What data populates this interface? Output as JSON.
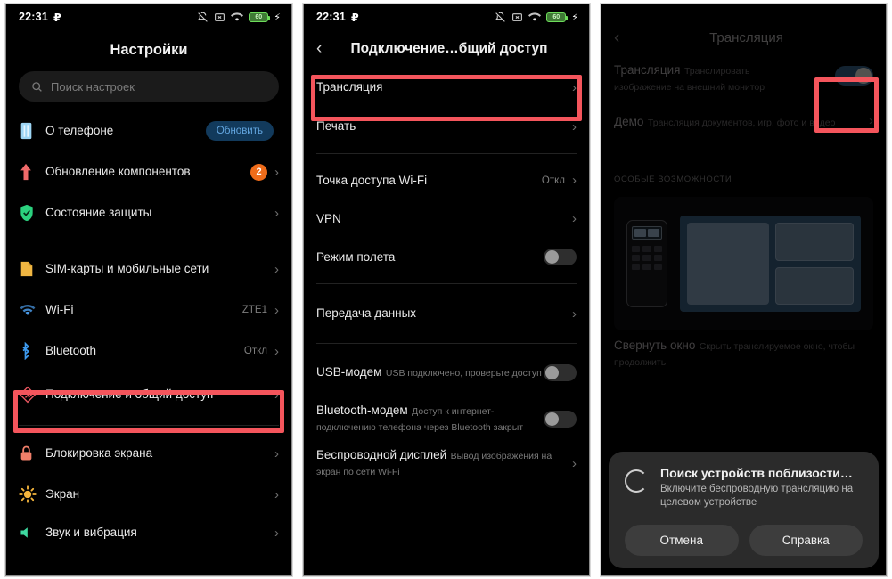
{
  "status_bar": {
    "time": "22:31",
    "currency_glyph": "₽",
    "icons": [
      "bell-off-icon",
      "no-sim-icon",
      "wifi-icon",
      "battery-icon",
      "charging-bolt-icon"
    ],
    "battery_level": "60"
  },
  "screen1": {
    "title": "Настройки",
    "search": {
      "placeholder": "Поиск настроек",
      "value": ""
    },
    "groups": [
      {
        "items": [
          {
            "label": "О телефоне",
            "icon": "phone-info-icon",
            "action_label": "Обновить",
            "action_type": "pill"
          },
          {
            "label": "Обновление компонентов",
            "icon": "up-arrow-icon",
            "badge": "2",
            "chevron": "›"
          },
          {
            "label": "Состояние защиты",
            "icon": "shield-check-icon",
            "chevron": "›"
          }
        ]
      },
      {
        "items": [
          {
            "label": "SIM-карты и мобильные сети",
            "icon": "sim-card-icon",
            "chevron": "›"
          },
          {
            "label": "Wi-Fi",
            "icon": "wifi-icon",
            "value": "ZTE1",
            "chevron": "›"
          },
          {
            "label": "Bluetooth",
            "icon": "bluetooth-icon",
            "value": "Откл",
            "chevron": "›"
          },
          {
            "label": "Подключение и общий доступ",
            "icon": "connection-share-icon",
            "chevron": "›",
            "highlighted": true
          }
        ]
      },
      {
        "items": [
          {
            "label": "Блокировка экрана",
            "icon": "lock-icon",
            "chevron": "›"
          },
          {
            "label": "Экран",
            "icon": "brightness-icon",
            "chevron": "›"
          },
          {
            "label": "Звук и вибрация",
            "icon": "sound-icon",
            "chevron": "›"
          }
        ]
      }
    ]
  },
  "screen2": {
    "back": "‹",
    "title": "Подключение…бщий доступ",
    "groups": [
      {
        "items": [
          {
            "label": "Трансляция",
            "chevron": "›",
            "highlighted": true
          },
          {
            "label": "Печать",
            "chevron": "›"
          }
        ]
      },
      {
        "items": [
          {
            "label": "Точка доступа Wi-Fi",
            "value": "Откл",
            "chevron": "›"
          },
          {
            "label": "VPN",
            "chevron": "›"
          },
          {
            "label": "Режим полета",
            "toggle": "off"
          }
        ]
      },
      {
        "items": [
          {
            "label": "Передача данных",
            "chevron": "›"
          }
        ]
      },
      {
        "items": [
          {
            "label": "USB-модем",
            "sub": "USB подключено, проверьте доступ",
            "toggle": "off"
          },
          {
            "label": "Bluetooth-модем",
            "sub": "Доступ к интернет-подключению телефона через Bluetooth закрыт",
            "toggle": "off"
          },
          {
            "label": "Беспроводной дисплей",
            "sub": "Вывод изображения на экран по сети Wi-Fi",
            "chevron": "›"
          }
        ]
      }
    ]
  },
  "screen3": {
    "back": "‹",
    "title": "Трансляция",
    "items": [
      {
        "label": "Трансляция",
        "sub": "Транслировать изображение на внешний монитор",
        "toggle": "on",
        "highlighted": true
      },
      {
        "label": "Демо",
        "sub": "Трансляция документов, игр, фото и видео",
        "chevron": "›"
      }
    ],
    "section_caption": "ОСОБЫЕ ВОЗМОЖНОСТИ",
    "feature": {
      "label": "Свернуть окно",
      "sub": "Скрыть транслируемое окно, чтобы продолжить"
    },
    "dialog": {
      "title": "Поиск устройств поблизости…",
      "message": "Включите беспроводную трансляцию на целевом устройстве",
      "cancel_label": "Отмена",
      "help_label": "Справка"
    }
  },
  "colors": {
    "highlight": "#f4555c",
    "accent_blue": "#63a6e0",
    "badge_orange": "#ef6c1a",
    "toggle_on": "#2c4f6e"
  }
}
